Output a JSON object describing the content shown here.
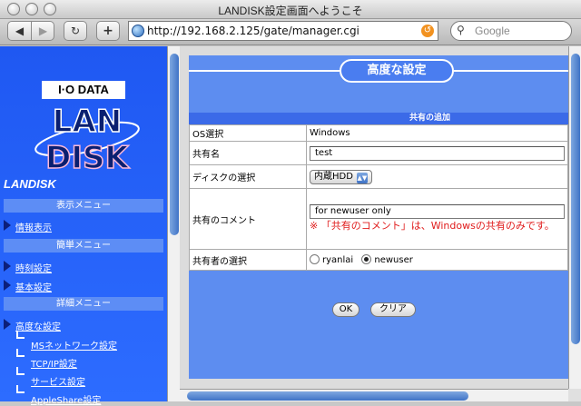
{
  "window": {
    "title": "LANDISK設定画面へようこそ"
  },
  "toolbar": {
    "back_glyph": "◀",
    "forward_glyph": "▶",
    "reload_glyph": "↻",
    "add_glyph": "+",
    "url": "http://192.168.2.125/gate/manager.cgi",
    "search_placeholder": "Google"
  },
  "sidebar": {
    "logo_brand": "I·O DATA",
    "logo_product_line1": "LAN",
    "logo_product_line2": "DISK",
    "title": "LANDISK",
    "sections": [
      {
        "header": "表示メニュー",
        "items": [
          "情報表示"
        ]
      },
      {
        "header": "簡単メニュー",
        "items": [
          "時刻設定",
          "基本設定"
        ]
      },
      {
        "header": "詳細メニュー",
        "items": [
          "高度な設定"
        ],
        "subitems": [
          "MSネットワーク設定",
          "TCP/IP設定",
          "サービス設定",
          "AppleShare設定"
        ]
      }
    ]
  },
  "main": {
    "page_title": "高度な設定",
    "section_header": "共有の追加",
    "rows": {
      "os": {
        "label": "OS選択",
        "value": "Windows"
      },
      "share_name": {
        "label": "共有名",
        "value": "test"
      },
      "disk": {
        "label": "ディスクの選択",
        "value": "内蔵HDD"
      },
      "comment": {
        "label": "共有のコメント",
        "value": "for newuser only",
        "note": "※ 「共有のコメント」は、Windowsの共有のみです。"
      },
      "user": {
        "label": "共有者の選択",
        "options": [
          "ryanlai",
          "newuser"
        ],
        "selected": "newuser"
      }
    },
    "ok_label": "OK",
    "clear_label": "クリア"
  },
  "colors": {
    "sidebar_blue": "#2563f5",
    "pane_blue": "#5d8df0",
    "note_red": "#e01b1b"
  }
}
